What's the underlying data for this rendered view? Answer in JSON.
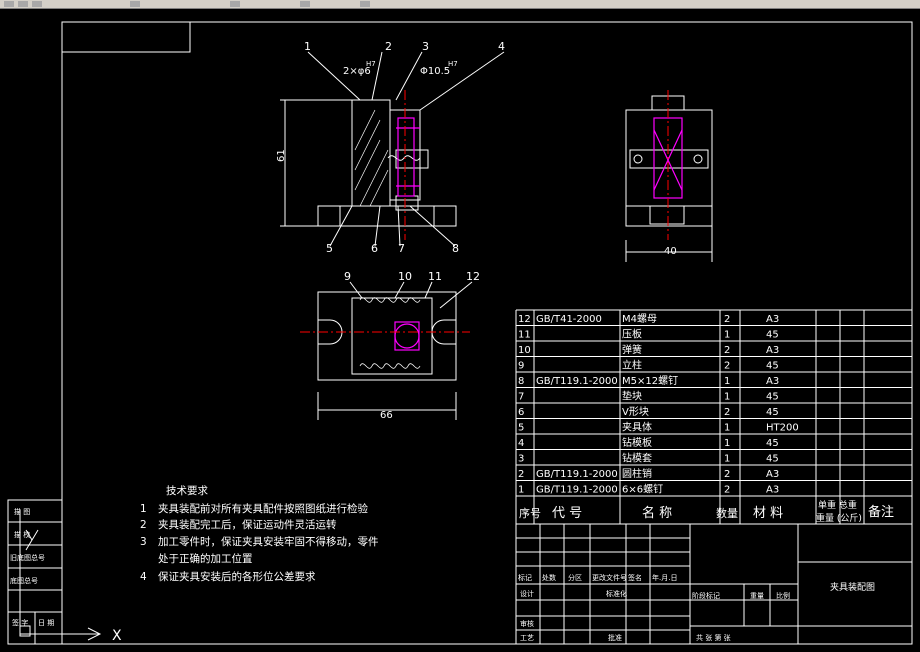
{
  "colors": {
    "background": "#000000",
    "line": "#ffffff",
    "dimension": "#ffffff",
    "highlight": "#ff00ff",
    "center": "#ff0000",
    "hatch": "#ffffff"
  },
  "drawing": {
    "front_view": {
      "balloons": [
        "1",
        "2",
        "3",
        "4",
        "5",
        "6",
        "7",
        "8"
      ],
      "dim_fit_1": "2×φ6",
      "dim_fit_1_tol": "H7",
      "dim_fit_2": "Φ10.5",
      "dim_fit_2_tol": "H7",
      "dim_height": "61"
    },
    "side_view": {
      "dim_width": "40"
    },
    "top_view": {
      "balloons": [
        "9",
        "10",
        "11",
        "12"
      ],
      "dim_width": "66"
    }
  },
  "tech_requirements": {
    "title": "技术要求",
    "items": [
      {
        "n": "1",
        "text": "夹具装配前对所有夹具配件按照图纸进行检验"
      },
      {
        "n": "2",
        "text": "夹具装配完工后，保证运动件灵活运转"
      },
      {
        "n": "3",
        "text": "加工零件时，保证夹具安装牢固不得移动，零件"
      },
      {
        "n": "",
        "text": "处于正确的加工位置"
      },
      {
        "n": "4",
        "text": "保证夹具安装后的各形位公差要求"
      }
    ]
  },
  "bom": {
    "header": {
      "seq": "序号",
      "code": "代  号",
      "name": "名  称",
      "qty": "数量",
      "material": "材  料",
      "weight_1": "单重 总重",
      "weight_2": "重量 (公斤)",
      "remark": "备注"
    },
    "rows": [
      {
        "seq": "12",
        "code": "GB/T41-2000",
        "name": "M4螺母",
        "qty": "2",
        "mat": "A3"
      },
      {
        "seq": "11",
        "code": "",
        "name": "压板",
        "qty": "1",
        "mat": "45"
      },
      {
        "seq": "10",
        "code": "",
        "name": "弹簧",
        "qty": "2",
        "mat": "A3"
      },
      {
        "seq": "9",
        "code": "",
        "name": "立柱",
        "qty": "2",
        "mat": "45"
      },
      {
        "seq": "8",
        "code": "GB/T119.1-2000",
        "name": "M5×12螺钉",
        "qty": "1",
        "mat": "A3"
      },
      {
        "seq": "7",
        "code": "",
        "name": "垫块",
        "qty": "1",
        "mat": "45"
      },
      {
        "seq": "6",
        "code": "",
        "name": "V形块",
        "qty": "2",
        "mat": "45"
      },
      {
        "seq": "5",
        "code": "",
        "name": "夹具体",
        "qty": "1",
        "mat": "HT200"
      },
      {
        "seq": "4",
        "code": "",
        "name": "钻模板",
        "qty": "1",
        "mat": "45"
      },
      {
        "seq": "3",
        "code": "",
        "name": "钻模套",
        "qty": "1",
        "mat": "45"
      },
      {
        "seq": "2",
        "code": "GB/T119.1-2000",
        "name": "圆柱销",
        "qty": "2",
        "mat": "A3"
      },
      {
        "seq": "1",
        "code": "GB/T119.1-2000",
        "name": "6×6螺钉",
        "qty": "2",
        "mat": "A3"
      }
    ]
  },
  "title_block": {
    "drawing_name": "夹具装配图",
    "row_labels": [
      "标记",
      "处数",
      "分区",
      "更改文件号",
      "签名",
      "年.月.日"
    ],
    "design": "设计",
    "standard": "标准化",
    "review": "审核",
    "process": "工艺",
    "approve": "批准",
    "stage": "阶段标记",
    "weight": "重量",
    "scale": "比例",
    "sheets": "共  张 第  张"
  },
  "side_strip": {
    "labels": [
      "描  图",
      "描  校",
      "旧底图总号",
      "底图总号",
      "签  字",
      "日  期"
    ]
  },
  "ucs": {
    "x": "X",
    "y": "Y"
  }
}
